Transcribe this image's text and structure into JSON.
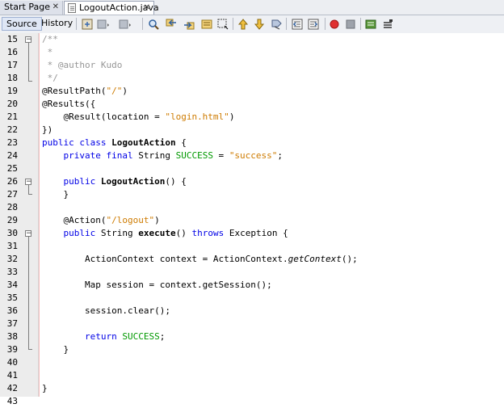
{
  "tabs": {
    "start_page": "Start Page",
    "logout_action": "LogoutAction.java",
    "close_glyph": "✕"
  },
  "toolbar": {
    "source_label": "Source",
    "history_label": "History",
    "icons": [
      "last-edit-icon",
      "back-icon",
      "forward-icon",
      "find-icon",
      "find-prev-icon",
      "find-next-icon",
      "toggle-highlight-icon",
      "toggle-rect-select-icon",
      "prev-bookmark-icon",
      "next-bookmark-icon",
      "toggle-bookmark-icon",
      "shift-left-icon",
      "shift-right-icon",
      "start-macro-icon",
      "stop-macro-icon",
      "comment-icon",
      "uncomment-icon"
    ]
  },
  "colors": {
    "keyword": "#0000e6",
    "string": "#ce7b00",
    "comment": "#969696",
    "constant": "#009900",
    "macro_record": "#e03030"
  },
  "editor": {
    "line_numbers": [
      "15",
      "16",
      "17",
      "18",
      "19",
      "20",
      "21",
      "22",
      "23",
      "24",
      "25",
      "26",
      "27",
      "28",
      "29",
      "30",
      "31",
      "32",
      "33",
      "34",
      "35",
      "36",
      "37",
      "38",
      "39",
      "40",
      "41",
      "42",
      "43"
    ],
    "lines": {
      "l15": "/**",
      "l16": " *",
      "l17": " * @author Kudo",
      "l18": " */",
      "l19_a": "@ResultPath(",
      "l19_s": "\"/\"",
      "l19_b": ")",
      "l20": "@Results({",
      "l21_a": "    @Result(location = ",
      "l21_s": "\"login.html\"",
      "l21_b": ")",
      "l22": "})",
      "l23_k": "public class",
      "l23_b": " LogoutAction",
      "l23_c": " {",
      "l24_indent": "    ",
      "l24_k": "private final",
      "l24_m": " String ",
      "l24_g": "SUCCESS",
      "l24_e": " = ",
      "l24_s": "\"success\"",
      "l24_z": ";",
      "l26_indent": "    ",
      "l26_k": "public",
      "l26_b": " LogoutAction",
      "l26_c": "() {",
      "l27": "    }",
      "l29_a": "    @Action(",
      "l29_s": "\"/logout\"",
      "l29_b": ")",
      "l30_indent": "    ",
      "l30_k": "public",
      "l30_m": " String ",
      "l30_b": "execute",
      "l30_n": "() ",
      "l30_k2": "throws",
      "l30_z": " Exception {",
      "l32_a": "        ActionContext context = ActionContext.",
      "l32_i": "getContext",
      "l32_b": "();",
      "l34": "        Map session = context.getSession();",
      "l36": "        session.clear();",
      "l38_indent": "        ",
      "l38_k": "return",
      "l38_sp": " ",
      "l38_g": "SUCCESS",
      "l38_z": ";",
      "l39": "    }",
      "l42": "}"
    }
  }
}
